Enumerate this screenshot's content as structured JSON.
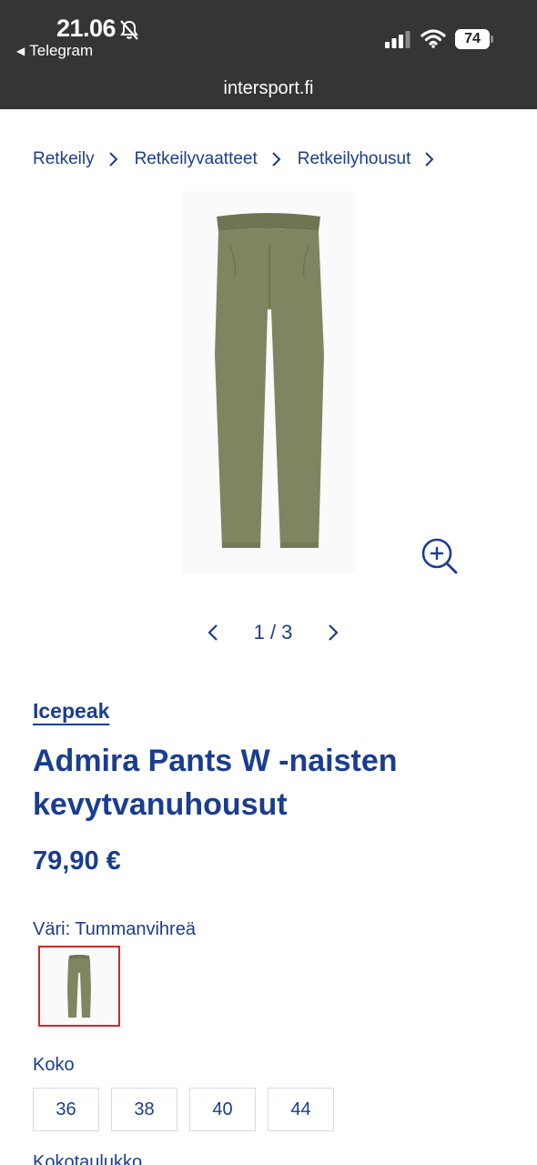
{
  "status_bar": {
    "time": "21.06",
    "back_app": "Telegram",
    "battery": "74",
    "url": "intersport.fi"
  },
  "breadcrumb": [
    {
      "label": "Retkeily"
    },
    {
      "label": "Retkeilyvaatteet"
    },
    {
      "label": "Retkeilyhousut"
    }
  ],
  "gallery": {
    "pager": "1 / 3"
  },
  "product": {
    "brand": "Icepeak",
    "title": "Admira Pants W -naisten kevytvanuhousut",
    "price": "79,90 €",
    "color_label": "Väri: Tummanvihreä",
    "color_hex": "#7f8560",
    "size_label": "Koko",
    "sizes": [
      "36",
      "38",
      "40",
      "44"
    ],
    "size_chart": "Kokotaulukko"
  },
  "colors": {
    "brand_blue": "#1a3d8f",
    "status_bar_bg": "#333537",
    "swatch_border": "#d4252b"
  }
}
